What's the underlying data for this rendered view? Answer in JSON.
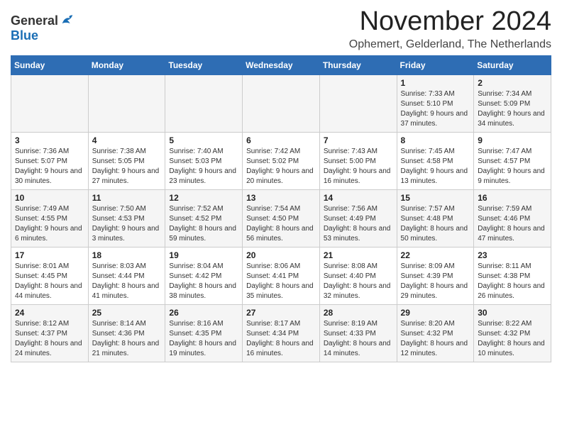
{
  "logo": {
    "general": "General",
    "blue": "Blue"
  },
  "header": {
    "month": "November 2024",
    "location": "Ophemert, Gelderland, The Netherlands"
  },
  "days_of_week": [
    "Sunday",
    "Monday",
    "Tuesday",
    "Wednesday",
    "Thursday",
    "Friday",
    "Saturday"
  ],
  "weeks": [
    [
      {
        "day": "",
        "info": ""
      },
      {
        "day": "",
        "info": ""
      },
      {
        "day": "",
        "info": ""
      },
      {
        "day": "",
        "info": ""
      },
      {
        "day": "",
        "info": ""
      },
      {
        "day": "1",
        "info": "Sunrise: 7:33 AM\nSunset: 5:10 PM\nDaylight: 9 hours and 37 minutes."
      },
      {
        "day": "2",
        "info": "Sunrise: 7:34 AM\nSunset: 5:09 PM\nDaylight: 9 hours and 34 minutes."
      }
    ],
    [
      {
        "day": "3",
        "info": "Sunrise: 7:36 AM\nSunset: 5:07 PM\nDaylight: 9 hours and 30 minutes."
      },
      {
        "day": "4",
        "info": "Sunrise: 7:38 AM\nSunset: 5:05 PM\nDaylight: 9 hours and 27 minutes."
      },
      {
        "day": "5",
        "info": "Sunrise: 7:40 AM\nSunset: 5:03 PM\nDaylight: 9 hours and 23 minutes."
      },
      {
        "day": "6",
        "info": "Sunrise: 7:42 AM\nSunset: 5:02 PM\nDaylight: 9 hours and 20 minutes."
      },
      {
        "day": "7",
        "info": "Sunrise: 7:43 AM\nSunset: 5:00 PM\nDaylight: 9 hours and 16 minutes."
      },
      {
        "day": "8",
        "info": "Sunrise: 7:45 AM\nSunset: 4:58 PM\nDaylight: 9 hours and 13 minutes."
      },
      {
        "day": "9",
        "info": "Sunrise: 7:47 AM\nSunset: 4:57 PM\nDaylight: 9 hours and 9 minutes."
      }
    ],
    [
      {
        "day": "10",
        "info": "Sunrise: 7:49 AM\nSunset: 4:55 PM\nDaylight: 9 hours and 6 minutes."
      },
      {
        "day": "11",
        "info": "Sunrise: 7:50 AM\nSunset: 4:53 PM\nDaylight: 9 hours and 3 minutes."
      },
      {
        "day": "12",
        "info": "Sunrise: 7:52 AM\nSunset: 4:52 PM\nDaylight: 8 hours and 59 minutes."
      },
      {
        "day": "13",
        "info": "Sunrise: 7:54 AM\nSunset: 4:50 PM\nDaylight: 8 hours and 56 minutes."
      },
      {
        "day": "14",
        "info": "Sunrise: 7:56 AM\nSunset: 4:49 PM\nDaylight: 8 hours and 53 minutes."
      },
      {
        "day": "15",
        "info": "Sunrise: 7:57 AM\nSunset: 4:48 PM\nDaylight: 8 hours and 50 minutes."
      },
      {
        "day": "16",
        "info": "Sunrise: 7:59 AM\nSunset: 4:46 PM\nDaylight: 8 hours and 47 minutes."
      }
    ],
    [
      {
        "day": "17",
        "info": "Sunrise: 8:01 AM\nSunset: 4:45 PM\nDaylight: 8 hours and 44 minutes."
      },
      {
        "day": "18",
        "info": "Sunrise: 8:03 AM\nSunset: 4:44 PM\nDaylight: 8 hours and 41 minutes."
      },
      {
        "day": "19",
        "info": "Sunrise: 8:04 AM\nSunset: 4:42 PM\nDaylight: 8 hours and 38 minutes."
      },
      {
        "day": "20",
        "info": "Sunrise: 8:06 AM\nSunset: 4:41 PM\nDaylight: 8 hours and 35 minutes."
      },
      {
        "day": "21",
        "info": "Sunrise: 8:08 AM\nSunset: 4:40 PM\nDaylight: 8 hours and 32 minutes."
      },
      {
        "day": "22",
        "info": "Sunrise: 8:09 AM\nSunset: 4:39 PM\nDaylight: 8 hours and 29 minutes."
      },
      {
        "day": "23",
        "info": "Sunrise: 8:11 AM\nSunset: 4:38 PM\nDaylight: 8 hours and 26 minutes."
      }
    ],
    [
      {
        "day": "24",
        "info": "Sunrise: 8:12 AM\nSunset: 4:37 PM\nDaylight: 8 hours and 24 minutes."
      },
      {
        "day": "25",
        "info": "Sunrise: 8:14 AM\nSunset: 4:36 PM\nDaylight: 8 hours and 21 minutes."
      },
      {
        "day": "26",
        "info": "Sunrise: 8:16 AM\nSunset: 4:35 PM\nDaylight: 8 hours and 19 minutes."
      },
      {
        "day": "27",
        "info": "Sunrise: 8:17 AM\nSunset: 4:34 PM\nDaylight: 8 hours and 16 minutes."
      },
      {
        "day": "28",
        "info": "Sunrise: 8:19 AM\nSunset: 4:33 PM\nDaylight: 8 hours and 14 minutes."
      },
      {
        "day": "29",
        "info": "Sunrise: 8:20 AM\nSunset: 4:32 PM\nDaylight: 8 hours and 12 minutes."
      },
      {
        "day": "30",
        "info": "Sunrise: 8:22 AM\nSunset: 4:32 PM\nDaylight: 8 hours and 10 minutes."
      }
    ]
  ]
}
